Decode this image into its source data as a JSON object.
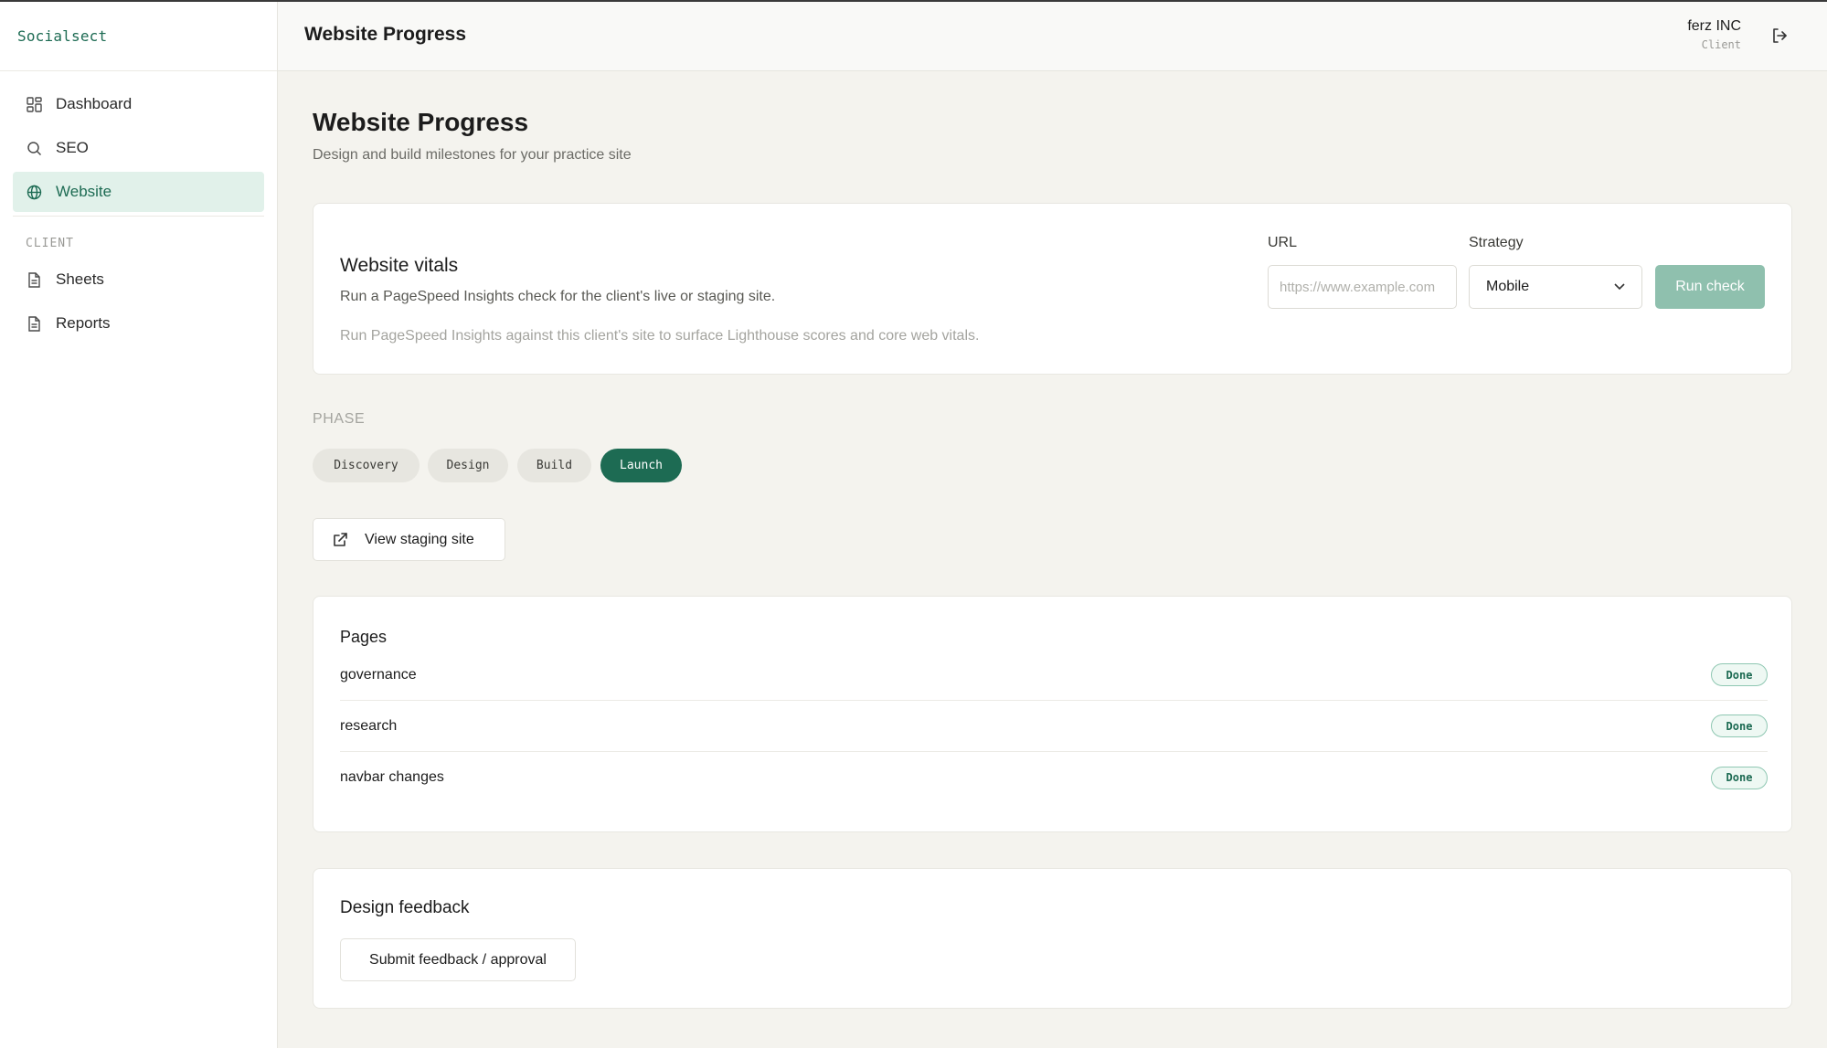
{
  "app": {
    "brand": "Socialsect"
  },
  "sidebar": {
    "items": [
      {
        "label": "Dashboard",
        "icon": "dashboard-grid-icon",
        "active": false
      },
      {
        "label": "SEO",
        "icon": "search-icon",
        "active": false
      },
      {
        "label": "Website",
        "icon": "globe-icon",
        "active": true
      }
    ],
    "section_label": "CLIENT",
    "client_items": [
      {
        "label": "Sheets",
        "icon": "document-icon"
      },
      {
        "label": "Reports",
        "icon": "document-icon"
      }
    ]
  },
  "header": {
    "title": "Website Progress",
    "user_name": "ferz INC",
    "user_role": "Client",
    "logout_icon": "logout-icon"
  },
  "main": {
    "title": "Website Progress",
    "subtitle": "Design and build milestones for your practice site",
    "vitals": {
      "title": "Website vitals",
      "description": "Run a PageSpeed Insights check for the client's live or staging site.",
      "hint": "Run PageSpeed Insights against this client's site to surface Lighthouse scores and core web vitals.",
      "url_label": "URL",
      "url_placeholder": "https://www.example.com",
      "strategy_label": "Strategy",
      "strategy_value": "Mobile",
      "run_label": "Run check"
    },
    "phase": {
      "label": "PHASE",
      "chips": [
        "Discovery",
        "Design",
        "Build",
        "Launch"
      ],
      "active": "Launch"
    },
    "staging_button": "View staging site",
    "pages": {
      "title": "Pages",
      "rows": [
        {
          "name": "governance",
          "status": "Done"
        },
        {
          "name": "research",
          "status": "Done"
        },
        {
          "name": "navbar changes",
          "status": "Done"
        }
      ]
    },
    "feedback": {
      "title": "Design feedback",
      "button": "Submit feedback / approval"
    }
  },
  "colors": {
    "accent": "#1d6b53",
    "accent_light": "#e1f1ea",
    "run_button": "#8fc0ae",
    "background": "#f4f3ee"
  }
}
